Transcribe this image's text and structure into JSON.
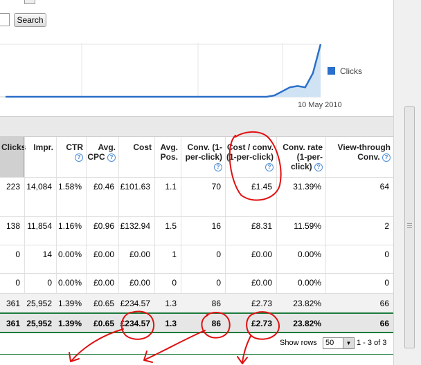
{
  "search": {
    "button_label": "Search"
  },
  "chart": {
    "legend_label": "Clicks",
    "x_tick": "10 May 2010",
    "colors": {
      "line": "#2a6fc9",
      "fill": "#cfe3f5"
    }
  },
  "chart_data": {
    "type": "area",
    "title": "",
    "series": [
      {
        "name": "Clicks",
        "values": [
          0,
          0,
          0,
          0,
          0,
          0,
          0,
          0,
          0,
          0,
          0,
          0,
          0,
          0,
          0,
          0,
          0,
          0,
          0,
          0,
          0,
          0,
          0,
          0,
          0,
          0,
          0,
          0,
          0,
          0,
          0,
          0,
          0,
          0,
          0,
          2,
          8,
          14,
          16,
          14,
          35,
          78
        ]
      }
    ],
    "x_tick_labels": [
      "10 May 2010"
    ],
    "grid": true,
    "legend_position": "right"
  },
  "table": {
    "headers": [
      {
        "label": "Clicks",
        "help": false
      },
      {
        "label": "Impr.",
        "help": false
      },
      {
        "label": "CTR",
        "help": true
      },
      {
        "label": "Avg. CPC",
        "help": true
      },
      {
        "label": "Cost",
        "help": false
      },
      {
        "label": "Avg. Pos.",
        "help": false
      },
      {
        "label": "Conv. (1-per-click)",
        "help": true
      },
      {
        "label": "Cost / conv. (1-per-click)",
        "help": true
      },
      {
        "label": "Conv. rate (1-per-click)",
        "help": true
      },
      {
        "label": "View-through Conv.",
        "help": true
      }
    ],
    "rows": [
      [
        "223",
        "14,084",
        "1.58%",
        "£0.46",
        "£101.63",
        "1.1",
        "70",
        "£1.45",
        "31.39%",
        "64"
      ],
      [
        "138",
        "11,854",
        "1.16%",
        "£0.96",
        "£132.94",
        "1.5",
        "16",
        "£8.31",
        "11.59%",
        "2"
      ],
      [
        "0",
        "14",
        "0.00%",
        "£0.00",
        "£0.00",
        "1",
        "0",
        "£0.00",
        "0.00%",
        "0"
      ],
      [
        "0",
        "0",
        "0.00%",
        "£0.00",
        "£0.00",
        "0",
        "0",
        "£0.00",
        "0.00%",
        "0"
      ]
    ],
    "total_row": [
      "361",
      "25,952",
      "1.39%",
      "£0.65",
      "£234.57",
      "1.3",
      "86",
      "£2.73",
      "23.82%",
      "66"
    ],
    "summary_row": [
      "361",
      "25,952",
      "1.39%",
      "£0.65",
      "£234.57",
      "1.3",
      "86",
      "£2.73",
      "23.82%",
      "66"
    ]
  },
  "pager": {
    "show_rows_label": "Show rows",
    "rows_per_page": "50",
    "range": "1 - 3 of 3"
  },
  "annotations": {
    "color": "#e01010"
  }
}
